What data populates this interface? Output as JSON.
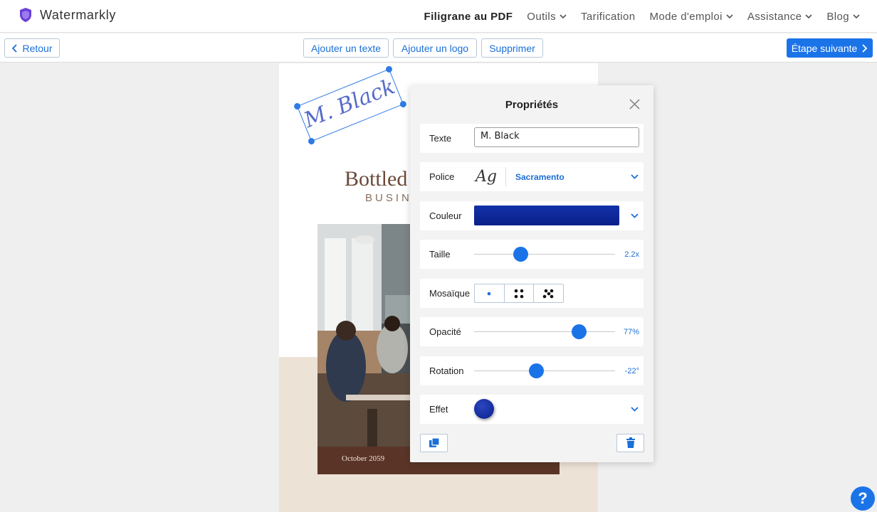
{
  "brand": {
    "name": "Watermarkly",
    "logo_icon": "shield-icon",
    "logo_color": "#6a3fd6"
  },
  "nav": {
    "items": [
      {
        "label": "Filigrane au PDF",
        "active": true,
        "dropdown": false
      },
      {
        "label": "Outils",
        "dropdown": true
      },
      {
        "label": "Tarification",
        "dropdown": false
      },
      {
        "label": "Mode d'emploi",
        "dropdown": true
      },
      {
        "label": "Assistance",
        "dropdown": true
      },
      {
        "label": "Blog",
        "dropdown": true
      }
    ]
  },
  "toolbar": {
    "back_label": "Retour",
    "add_text_label": "Ajouter un texte",
    "add_logo_label": "Ajouter un logo",
    "delete_label": "Supprimer",
    "next_label": "Étape suivante",
    "accent_color": "#1b73e8"
  },
  "document": {
    "title": "Bottled",
    "subtitle": "BUSIN",
    "date": "October 2059"
  },
  "watermark": {
    "text": "M. Black",
    "rotation_deg": -22
  },
  "panel": {
    "title": "Propriétés",
    "text": {
      "label": "Texte",
      "value": "M. Black"
    },
    "font": {
      "label": "Police",
      "sample": "Ag",
      "name": "Sacramento"
    },
    "color": {
      "label": "Couleur",
      "value": "#0b1f8a"
    },
    "size": {
      "label": "Taille",
      "value_text": "2.2x",
      "fraction": 0.33
    },
    "mosaic": {
      "label": "Mosaïque",
      "options": [
        "single",
        "grid-4",
        "diagonal-5"
      ]
    },
    "opacity": {
      "label": "Opacité",
      "value_text": "77%",
      "fraction": 0.745
    },
    "rotation": {
      "label": "Rotation",
      "value_text": "-22°",
      "fraction": 0.44
    },
    "effect": {
      "label": "Effet"
    }
  },
  "help": {
    "label": "?"
  }
}
